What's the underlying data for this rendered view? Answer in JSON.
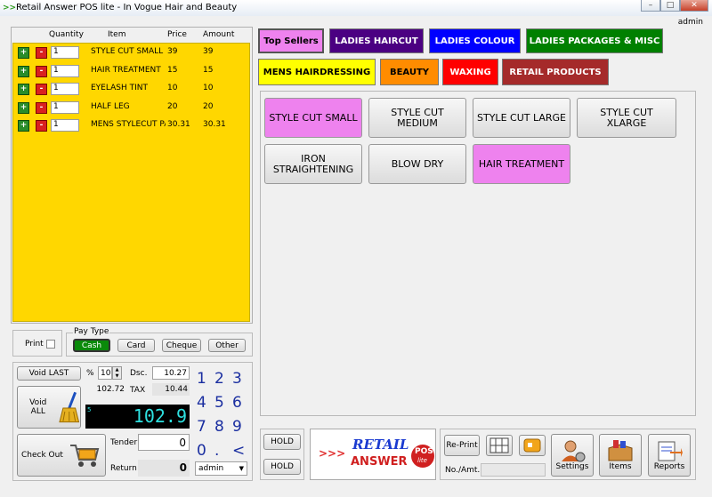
{
  "window": {
    "title": "Retail Answer POS lite - In Vogue Hair and Beauty",
    "user": "admin",
    "min_label": "–",
    "max_label": "□",
    "close_label": "✕",
    "app_icon": ">>"
  },
  "order": {
    "headers": {
      "quantity": "Quantity",
      "item": "Item",
      "price": "Price",
      "amount": "Amount"
    },
    "plus_label": "+",
    "minus_label": "-",
    "rows": [
      {
        "qty": "1",
        "item": "STYLE CUT SMALL",
        "price": "39",
        "amount": "39"
      },
      {
        "qty": "1",
        "item": "HAIR TREATMENT",
        "price": "15",
        "amount": "15"
      },
      {
        "qty": "1",
        "item": "EYELASH TINT",
        "price": "10",
        "amount": "10"
      },
      {
        "qty": "1",
        "item": "HALF LEG",
        "price": "20",
        "amount": "20"
      },
      {
        "qty": "1",
        "item": "MENS STYLECUT PA",
        "price": "30.31",
        "amount": "30.31"
      }
    ]
  },
  "categories": [
    {
      "label": "Top Sellers",
      "bg": "#ee82ee",
      "fg": "#000000"
    },
    {
      "label": "LADIES HAIRCUT",
      "bg": "#4b0082",
      "fg": "#ffffff"
    },
    {
      "label": "LADIES COLOUR",
      "bg": "#0000ff",
      "fg": "#ffffff"
    },
    {
      "label": "LADIES PACKAGES & MISC",
      "bg": "#008000",
      "fg": "#ffffff"
    },
    {
      "label": "MENS HAIRDRESSING",
      "bg": "#ffff00",
      "fg": "#000000"
    },
    {
      "label": "BEAUTY",
      "bg": "#ff8c00",
      "fg": "#000000"
    },
    {
      "label": "WAXING",
      "bg": "#ff0000",
      "fg": "#ffffff"
    },
    {
      "label": "RETAIL PRODUCTS",
      "bg": "#a52a2a",
      "fg": "#ffffff"
    }
  ],
  "products": [
    {
      "label": "STYLE CUT SMALL",
      "highlight": true
    },
    {
      "label": "STYLE CUT MEDIUM",
      "highlight": false
    },
    {
      "label": "STYLE CUT LARGE",
      "highlight": false
    },
    {
      "label": "STYLE CUT XLARGE",
      "highlight": false
    },
    {
      "label": "IRON STRAIGHTENING",
      "highlight": false
    },
    {
      "label": "BLOW DRY",
      "highlight": false
    },
    {
      "label": "HAIR TREATMENT",
      "highlight": true
    }
  ],
  "payment": {
    "print_label": "Print",
    "pay_type_label": "Pay Type",
    "cash": "Cash",
    "card": "Card",
    "cheque": "Cheque",
    "other": "Other"
  },
  "totals": {
    "void_last": "Void LAST",
    "percent_sign": "%",
    "percent_value": "10",
    "dsc_label": "Dsc.",
    "dsc_value": "10.27",
    "subtotal": "102.72",
    "tax_label": "TAX",
    "tax_value": "10.44",
    "void_all": "Void ALL",
    "item_count": "5",
    "total": "102.9",
    "check_out": "Check Out",
    "tender_label": "Tender",
    "tender_value": "0",
    "return_label": "Return",
    "return_value": "0",
    "user_select": "admin"
  },
  "numpad": [
    "1",
    "2",
    "3",
    "4",
    "5",
    "6",
    "7",
    "8",
    "9",
    "0",
    ".",
    "<"
  ],
  "bottom": {
    "hold1": "HOLD",
    "hold2": "HOLD",
    "logo_retail": "RETAIL",
    "logo_answer": "ANSWER",
    "logo_pos": "POS",
    "logo_lite": "lite",
    "logo_arrows": ">>>",
    "reprint": "Re-Print",
    "no_amt": "No./Amt.",
    "settings": "Settings",
    "items": "Items",
    "reports": "Reports"
  }
}
